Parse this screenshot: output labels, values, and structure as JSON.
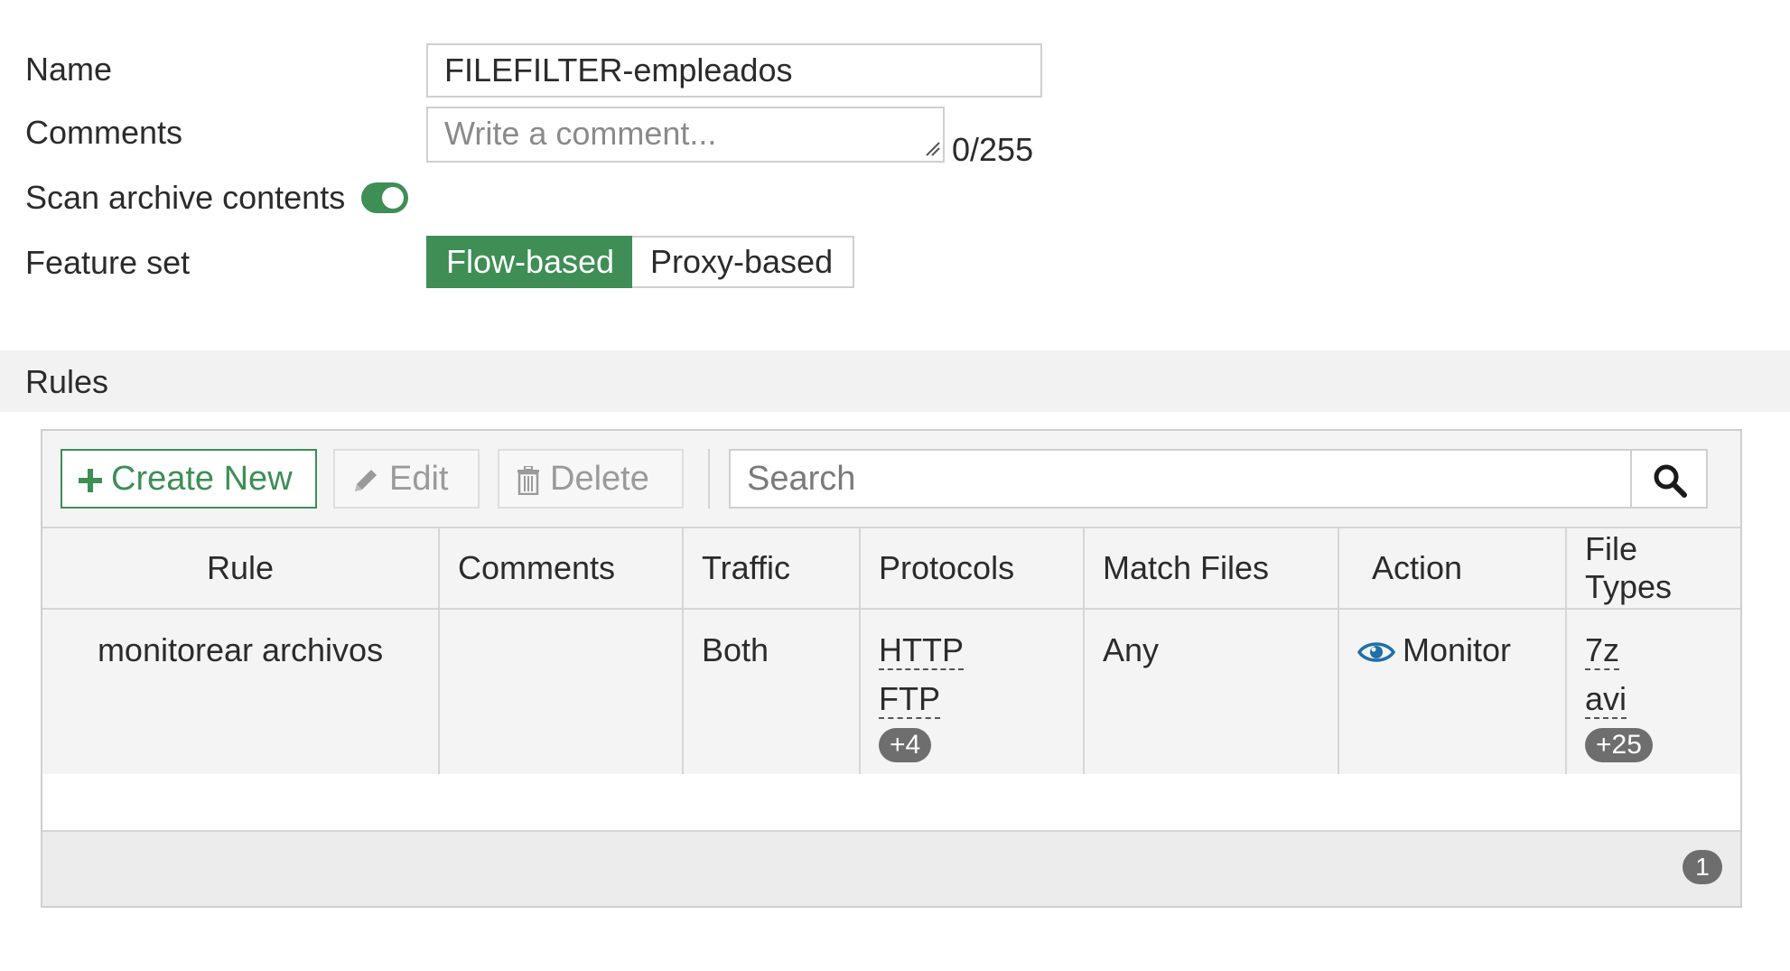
{
  "form": {
    "name_label": "Name",
    "name_value": "FILEFILTER-empleados",
    "comments_label": "Comments",
    "comments_placeholder": "Write a comment...",
    "comments_counter": "0/255",
    "scan_archive_label": "Scan archive contents",
    "scan_archive_enabled": true,
    "feature_set_label": "Feature set",
    "feature_set_options": [
      "Flow-based",
      "Proxy-based"
    ],
    "feature_set_selected": "Flow-based"
  },
  "rules": {
    "section_title": "Rules",
    "toolbar": {
      "create_label": "Create New",
      "edit_label": "Edit",
      "delete_label": "Delete",
      "search_placeholder": "Search"
    },
    "columns": [
      "Rule",
      "Comments",
      "Traffic",
      "Protocols",
      "Match Files",
      "Action",
      "File Types"
    ],
    "rows": [
      {
        "rule": "monitorear archivos",
        "comments": "",
        "traffic": "Both",
        "protocols": [
          "HTTP",
          "FTP"
        ],
        "protocols_more": "+4",
        "match_files": "Any",
        "action": "Monitor",
        "file_types": [
          "7z",
          "avi"
        ],
        "file_types_more": "+25"
      }
    ],
    "count": "1"
  },
  "colors": {
    "accent_green": "#3e8e55",
    "action_icon_blue": "#1f6fa8"
  }
}
